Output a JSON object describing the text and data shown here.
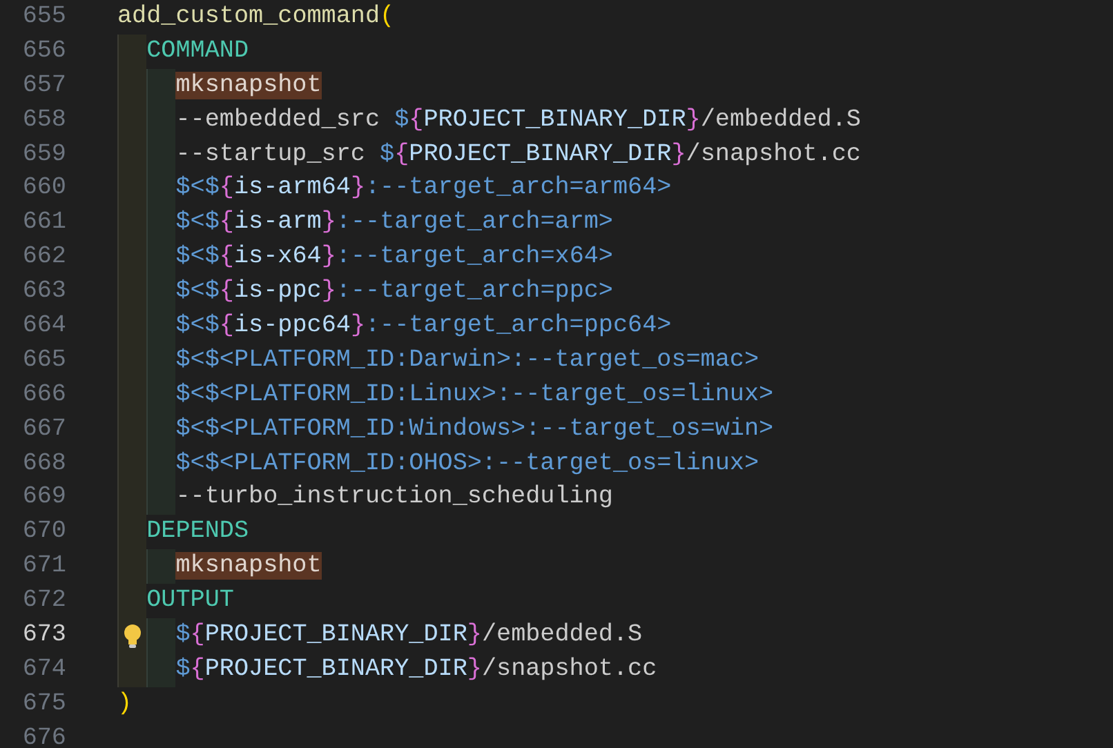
{
  "lines": [
    {
      "number": "655",
      "current": false,
      "tokens": [
        {
          "text": "add_custom_command",
          "kind": "func"
        },
        {
          "text": "(",
          "kind": "paren"
        }
      ],
      "children": [
        {
          "number": "656",
          "current": false,
          "tokens": [
            {
              "text": "COMMAND",
              "kind": "keyword"
            }
          ],
          "children": [
            {
              "number": "657",
              "current": false,
              "tokens": [
                {
                  "text": "mksnapshot",
                  "kind": "match"
                }
              ]
            },
            {
              "number": "658",
              "current": false,
              "tokens": [
                {
                  "text": "--embedded_src ",
                  "kind": "plain"
                },
                {
                  "text": "$",
                  "kind": "gen"
                },
                {
                  "text": "{",
                  "kind": "brace"
                },
                {
                  "text": "PROJECT_BINARY_DIR",
                  "kind": "var"
                },
                {
                  "text": "}",
                  "kind": "brace"
                },
                {
                  "text": "/embedded.S",
                  "kind": "plain"
                }
              ]
            },
            {
              "number": "659",
              "current": false,
              "tokens": [
                {
                  "text": "--startup_src ",
                  "kind": "plain"
                },
                {
                  "text": "$",
                  "kind": "gen"
                },
                {
                  "text": "{",
                  "kind": "brace"
                },
                {
                  "text": "PROJECT_BINARY_DIR",
                  "kind": "var"
                },
                {
                  "text": "}",
                  "kind": "brace"
                },
                {
                  "text": "/snapshot.cc",
                  "kind": "plain"
                }
              ]
            },
            {
              "number": "660",
              "current": false,
              "tokens": [
                {
                  "text": "$<$",
                  "kind": "gen"
                },
                {
                  "text": "{",
                  "kind": "brace"
                },
                {
                  "text": "is-arm64",
                  "kind": "var"
                },
                {
                  "text": "}",
                  "kind": "brace"
                },
                {
                  "text": ":--target_arch=arm64>",
                  "kind": "gen"
                }
              ]
            },
            {
              "number": "661",
              "current": false,
              "tokens": [
                {
                  "text": "$<$",
                  "kind": "gen"
                },
                {
                  "text": "{",
                  "kind": "brace"
                },
                {
                  "text": "is-arm",
                  "kind": "var"
                },
                {
                  "text": "}",
                  "kind": "brace"
                },
                {
                  "text": ":--target_arch=arm>",
                  "kind": "gen"
                }
              ]
            },
            {
              "number": "662",
              "current": false,
              "tokens": [
                {
                  "text": "$<$",
                  "kind": "gen"
                },
                {
                  "text": "{",
                  "kind": "brace"
                },
                {
                  "text": "is-x64",
                  "kind": "var"
                },
                {
                  "text": "}",
                  "kind": "brace"
                },
                {
                  "text": ":--target_arch=x64>",
                  "kind": "gen"
                }
              ]
            },
            {
              "number": "663",
              "current": false,
              "tokens": [
                {
                  "text": "$<$",
                  "kind": "gen"
                },
                {
                  "text": "{",
                  "kind": "brace"
                },
                {
                  "text": "is-ppc",
                  "kind": "var"
                },
                {
                  "text": "}",
                  "kind": "brace"
                },
                {
                  "text": ":--target_arch=ppc>",
                  "kind": "gen"
                }
              ]
            },
            {
              "number": "664",
              "current": false,
              "tokens": [
                {
                  "text": "$<$",
                  "kind": "gen"
                },
                {
                  "text": "{",
                  "kind": "brace"
                },
                {
                  "text": "is-ppc64",
                  "kind": "var"
                },
                {
                  "text": "}",
                  "kind": "brace"
                },
                {
                  "text": ":--target_arch=ppc64>",
                  "kind": "gen"
                }
              ]
            },
            {
              "number": "665",
              "current": false,
              "tokens": [
                {
                  "text": "$<$<PLATFORM_ID:Darwin>:--target_os=mac>",
                  "kind": "gen"
                }
              ]
            },
            {
              "number": "666",
              "current": false,
              "tokens": [
                {
                  "text": "$<$<PLATFORM_ID:Linux>:--target_os=linux>",
                  "kind": "gen"
                }
              ]
            },
            {
              "number": "667",
              "current": false,
              "tokens": [
                {
                  "text": "$<$<PLATFORM_ID:Windows>:--target_os=win>",
                  "kind": "gen"
                }
              ]
            },
            {
              "number": "668",
              "current": false,
              "tokens": [
                {
                  "text": "$<$<PLATFORM_ID:OHOS>:--target_os=linux>",
                  "kind": "gen"
                }
              ]
            },
            {
              "number": "669",
              "current": false,
              "tokens": [
                {
                  "text": "--turbo_instruction_scheduling",
                  "kind": "plain"
                }
              ]
            }
          ]
        },
        {
          "number": "670",
          "current": false,
          "tokens": [
            {
              "text": "DEPENDS",
              "kind": "keyword"
            }
          ],
          "children": [
            {
              "number": "671",
              "current": false,
              "tokens": [
                {
                  "text": "mksnapshot",
                  "kind": "match"
                }
              ]
            }
          ]
        },
        {
          "number": "672",
          "current": false,
          "tokens": [
            {
              "text": "OUTPUT",
              "kind": "keyword"
            }
          ],
          "children": [
            {
              "number": "673",
              "current": true,
              "lightbulb": true,
              "tokens": [
                {
                  "text": "$",
                  "kind": "gen"
                },
                {
                  "text": "{",
                  "kind": "brace"
                },
                {
                  "text": "PROJECT_BINARY_DIR",
                  "kind": "var"
                },
                {
                  "text": "}",
                  "kind": "brace"
                },
                {
                  "text": "/embedded.S",
                  "kind": "plain"
                }
              ]
            },
            {
              "number": "674",
              "current": false,
              "tokens": [
                {
                  "text": "$",
                  "kind": "gen"
                },
                {
                  "text": "{",
                  "kind": "brace"
                },
                {
                  "text": "PROJECT_BINARY_DIR",
                  "kind": "var"
                },
                {
                  "text": "}",
                  "kind": "brace"
                },
                {
                  "text": "/snapshot.cc",
                  "kind": "plain"
                }
              ]
            }
          ]
        }
      ]
    },
    {
      "number": "675",
      "current": false,
      "tokens": [
        {
          "text": ")",
          "kind": "paren"
        }
      ]
    },
    {
      "number": "676",
      "current": false
    }
  ]
}
